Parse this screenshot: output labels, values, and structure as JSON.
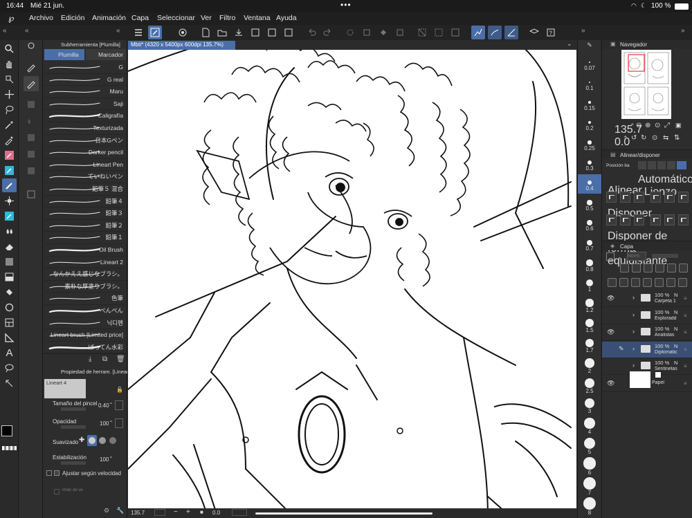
{
  "status": {
    "time": "16:44",
    "date": "Mié 21 jun.",
    "battery": "100 %"
  },
  "menu": {
    "items": [
      "Archivo",
      "Edición",
      "Animación",
      "Capa",
      "Seleccionar",
      "Ver",
      "Filtro",
      "Ventana",
      "Ayuda"
    ]
  },
  "subtool": {
    "title": "Subherramienta [Plumilla]",
    "tabs": [
      "Plumilla",
      "Marcador"
    ]
  },
  "brushes": [
    "G",
    "G real",
    "Maru",
    "Saji",
    "Caligrafía",
    "Texturizada",
    "日本Gペン",
    "Darker pencil",
    "Lineart Pen",
    "ていねいペン",
    "鉛筆５ 混合",
    "鉛筆４",
    "鉛筆３",
    "鉛筆２",
    "鉛筆１",
    "Oil Brush",
    "Lineart 2",
    "なんかええ感じなブラシ。",
    "素朴な厚塗りブラシ。",
    "色筆",
    "ぺんぺん",
    "닉디펜",
    "Lineart brush [Limited price]",
    "ばってん水彩"
  ],
  "toolprop": {
    "title": "Propiedad de herram. [Lineart 4]",
    "preset": "Lineart 4",
    "brush_size_label": "Tamaño del pincel",
    "brush_size": "0.40",
    "opacity_label": "Opacidad",
    "opacity": "100",
    "smoothing_label": "Suavizado",
    "stabilization_label": "Estabilización",
    "stabilization": "100",
    "speed_label": "Ajustar según velocidad",
    "magnet_label": "Imán de ve"
  },
  "canvas": {
    "tab": "Mbti* (4320 x 5400px 600dpi 135.7%)",
    "zoom": "135.7",
    "angle": "0.0"
  },
  "sizes": [
    "0.07",
    "0.1",
    "0.15",
    "0.2",
    "0.25",
    "0.3",
    "0.4",
    "0.5",
    "0.6",
    "0.7",
    "0.8",
    "1",
    "1.2",
    "1.5",
    "1.7",
    "2",
    "2.5",
    "3",
    "4",
    "5",
    "6",
    "7",
    "8"
  ],
  "navigator": {
    "title": "Navegador",
    "zoom": "135.7",
    "angle": "0.0"
  },
  "align": {
    "title": "Alinear/disponer",
    "position_label": "Posición ba",
    "auto_label": "Automático : Lienzo",
    "align_label": "Alinear",
    "arrange_label": "Disponer",
    "equidistant_label": "Disponer de forma equidistante"
  },
  "layers": {
    "title": "Capa",
    "mode_placeholder": "Norm",
    "items": [
      {
        "pct": "100 %",
        "mode": "N",
        "name": "Carpeta 1"
      },
      {
        "pct": "100 %",
        "mode": "N",
        "name": "Exploradd"
      },
      {
        "pct": "100 %",
        "mode": "N",
        "name": "Analistas"
      },
      {
        "pct": "100 %",
        "mode": "N",
        "name": "Diplomatic"
      },
      {
        "pct": "100 %",
        "mode": "N",
        "name": "Sentinelas"
      },
      {
        "pct": "",
        "mode": "",
        "name": "Papel"
      }
    ]
  },
  "colors": {
    "accent": "#4a6ea8",
    "selected_layer": "#3a4f75",
    "bg": "#2d2d2d",
    "fg_swatch": "#000000",
    "bg_swatch": "#c7624e"
  }
}
